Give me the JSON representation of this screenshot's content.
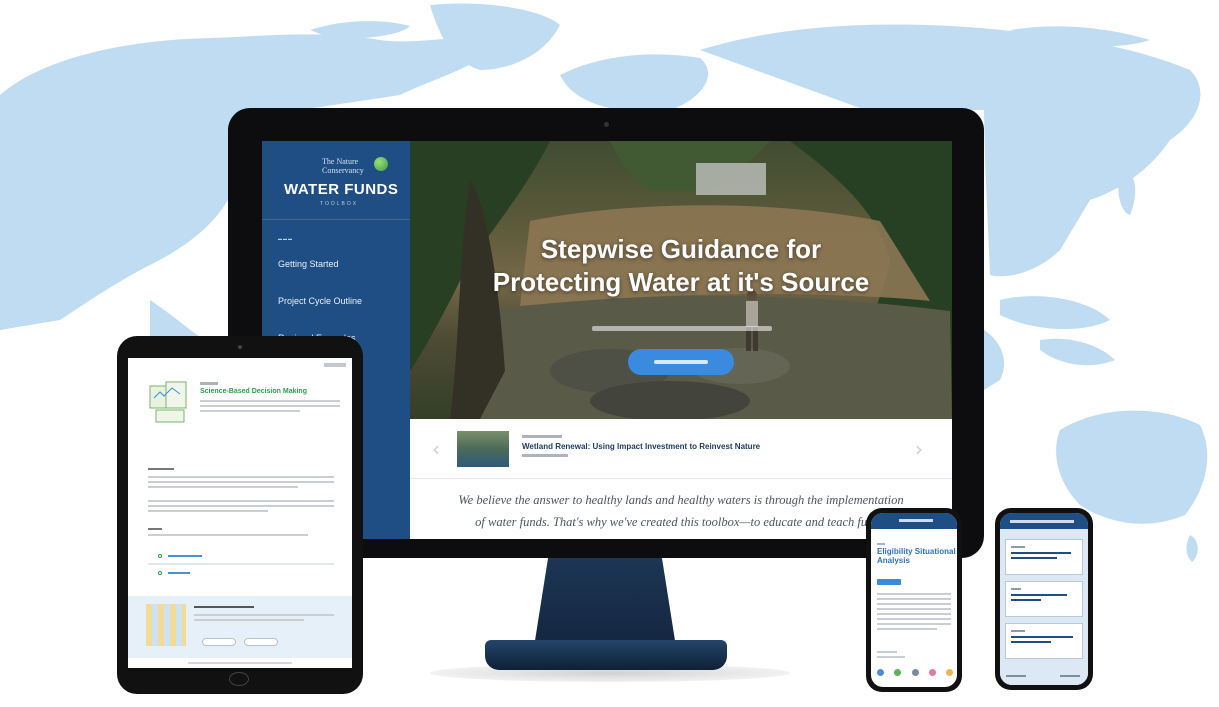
{
  "desktop": {
    "sidebar": {
      "logo_org": "The Nature Conservancy",
      "logo_title": "WATER FUNDS",
      "logo_subtitle": "TOOLBOX",
      "nav": [
        "Getting Started",
        "Project Cycle Outline",
        "Regional Examples"
      ]
    },
    "hero": {
      "title_line1": "Stepwise Guidance for",
      "title_line2": "Protecting Water at it's Source"
    },
    "feature": {
      "headline": "Wetland Renewal: Using Impact Investment to Reinvest Nature"
    },
    "quote": {
      "line1": "We believe the answer to healthy lands and healthy waters is through the implementation",
      "line2": "of water funds. That's why we've created this toolbox—to educate and teach future"
    }
  },
  "tablet": {
    "title": "Science-Based Decision Making"
  },
  "phone1": {
    "title": "Eligibility Situational Analysis"
  },
  "colors": {
    "brand_blue": "#1f4e84",
    "accent_blue": "#3a8be0",
    "map_blue": "#bcd9f1",
    "green_title": "#2f9e4b"
  }
}
